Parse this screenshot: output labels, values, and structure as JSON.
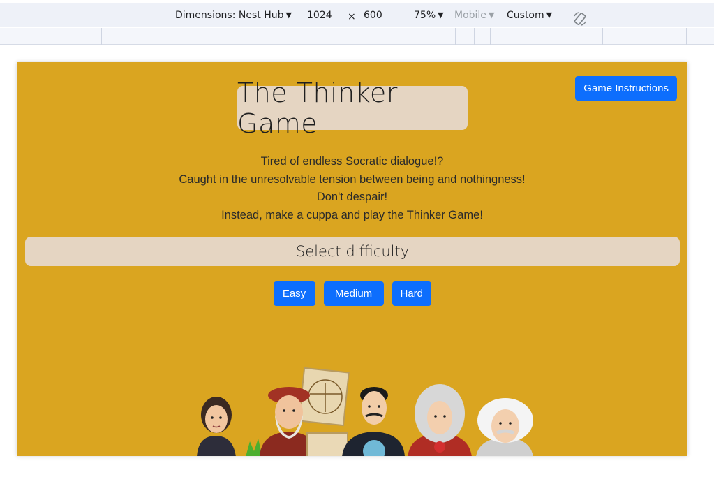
{
  "devtools": {
    "dimensions_label": "Dimensions: Nest Hub",
    "width": "1024",
    "times": "×",
    "height": "600",
    "zoom": "75%",
    "device_type": "Mobile",
    "throttle": "Custom",
    "rotate_icon": "rotate-icon"
  },
  "page": {
    "instructions_button": "Game Instructions",
    "title": "The Thinker Game",
    "intro_lines": [
      "Tired of endless Socratic dialogue!?",
      "Caught in the unresolvable tension between being and nothingness!",
      "Don't despair!",
      "Instead, make a cuppa and play the Thinker Game!"
    ],
    "difficulty_heading": "Select difficulty",
    "difficulty_buttons": [
      "Easy",
      "Medium",
      "Hard"
    ]
  },
  "colors": {
    "background": "#daa520",
    "panel": "#e5d5c2",
    "button": "#0d6efd"
  }
}
